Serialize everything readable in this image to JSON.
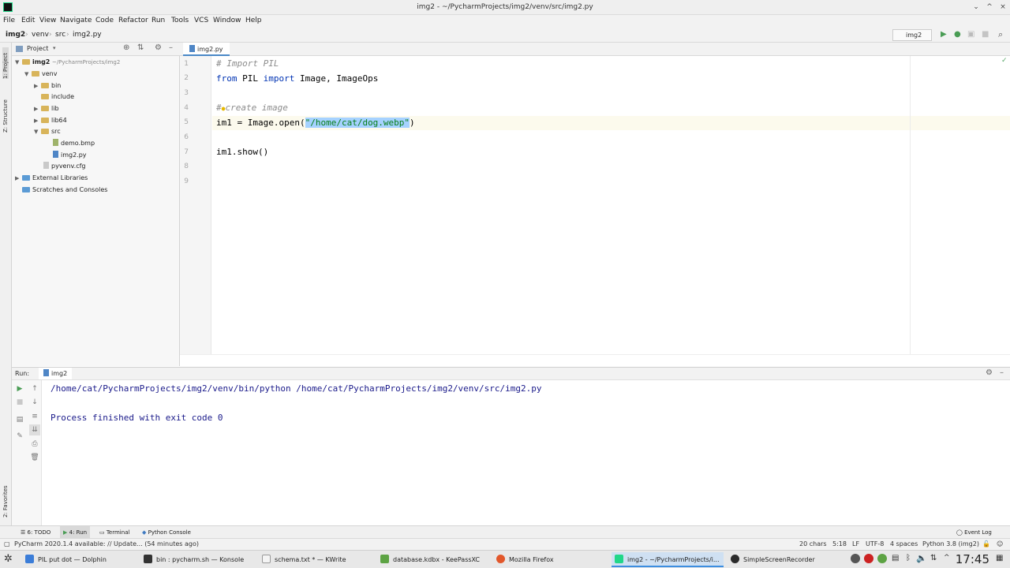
{
  "window": {
    "title": "img2 - ~/PycharmProjects/img2/venv/src/img2.py",
    "controls": [
      "⌄",
      "^",
      "×"
    ]
  },
  "menu": [
    "File",
    "Edit",
    "View",
    "Navigate",
    "Code",
    "Refactor",
    "Run",
    "Tools",
    "VCS",
    "Window",
    "Help"
  ],
  "breadcrumbs": [
    "img2",
    "venv",
    "src",
    "img2.py"
  ],
  "run_config": "img2",
  "left_strip": {
    "project": "1: Project",
    "structure": "Z: Structure",
    "favorites": "2: Favorites"
  },
  "project_panel": {
    "title": "Project",
    "tree": [
      {
        "label": "img2",
        "extra": "~/PycharmProjects/img2"
      },
      {
        "label": "venv"
      },
      {
        "label": "bin"
      },
      {
        "label": "include"
      },
      {
        "label": "lib"
      },
      {
        "label": "lib64"
      },
      {
        "label": "src"
      },
      {
        "label": "demo.bmp"
      },
      {
        "label": "img2.py"
      },
      {
        "label": "pyvenv.cfg"
      },
      {
        "label": "External Libraries"
      },
      {
        "label": "Scratches and Consoles"
      }
    ]
  },
  "editor": {
    "tab": "img2.py",
    "line_numbers": [
      "1",
      "2",
      "3",
      "4",
      "5",
      "6",
      "7",
      "8",
      "9"
    ],
    "lines": {
      "l1": "# Import PIL",
      "l2_kw1": "from",
      "l2_mid": " PIL ",
      "l2_kw2": "import",
      "l2_rest": " Image, ImageOps",
      "l4_hash": "#",
      "l4_rest": "create image",
      "l5_pre": "im1 = Image.open(",
      "l5_str": "\"/home/cat/dog.webp\"",
      "l5_post": ")",
      "l7": "im1.show()"
    }
  },
  "run_panel": {
    "label": "Run:",
    "config": "img2",
    "output": [
      "/home/cat/PycharmProjects/img2/venv/bin/python /home/cat/PycharmProjects/img2/venv/src/img2.py",
      "Process finished with exit code 0"
    ]
  },
  "tool_tabs": [
    "6: TODO",
    "4: Run",
    "Terminal",
    "Python Console"
  ],
  "event_log": "Event Log",
  "status": {
    "message": "PyCharm 2020.1.4 available: // Update... (54 minutes ago)",
    "chars": "20 chars",
    "position": "5:18",
    "line_sep": "LF",
    "encoding": "UTF-8",
    "indent": "4 spaces",
    "interpreter": "Python 3.8 (img2)"
  },
  "taskbar": {
    "tasks": [
      {
        "label": "PIL put dot — Dolphin",
        "color": "#3b7dd8"
      },
      {
        "label": "bin : pycharm.sh — Konsole",
        "color": "#333333"
      },
      {
        "label": "schema.txt * — KWrite",
        "color": "#f4f4f4"
      },
      {
        "label": "database.kdbx - KeePassXC",
        "color": "#5da344"
      },
      {
        "label": "Mozilla Firefox",
        "color": "#e2572b"
      },
      {
        "label": "img2 - ~/PycharmProjects/i...",
        "color": "#21d789"
      },
      {
        "label": "SimpleScreenRecorder",
        "color": "#2b2b2b"
      }
    ],
    "clock": "17:45"
  },
  "colors": {
    "keyword": "#0033b3",
    "comment": "#8c8c8c",
    "string": "#067d17",
    "selection": "#a6d2ff",
    "output": "#1a1a8a"
  }
}
